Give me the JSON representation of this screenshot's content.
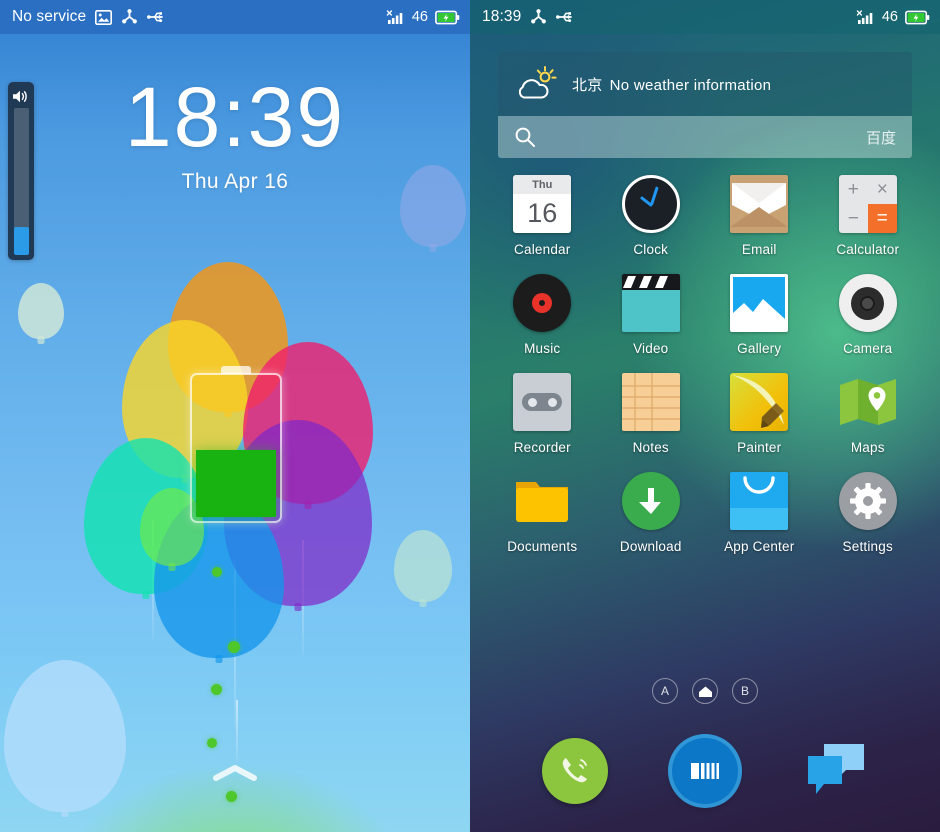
{
  "lock_screen": {
    "status_bar": {
      "carrier": "No service",
      "icons": [
        "screenshot-icon",
        "node-share-icon",
        "usb-icon"
      ],
      "signal_icon": "signal-no-service-icon",
      "battery_percent": "46",
      "battery_icon": "battery-charging-icon"
    },
    "time": "18:39",
    "date": "Thu  Apr 16",
    "volume_slider": {
      "name": "volume-slider",
      "icon": "speaker-icon",
      "level_percent": 19
    },
    "battery_widget": {
      "name": "battery-level-widget",
      "fill_percent": 46
    },
    "unlock_hint_icon": "chevron-up-icon",
    "wallpaper": "balloons"
  },
  "home_screen": {
    "status_bar": {
      "time": "18:39",
      "icons": [
        "node-share-icon",
        "usb-icon"
      ],
      "signal_icon": "signal-no-service-icon",
      "battery_percent": "46",
      "battery_icon": "battery-charging-icon"
    },
    "weather_widget": {
      "icon": "cloud-sun-icon",
      "city": "北京",
      "status": "No weather information"
    },
    "search_bar": {
      "icon": "search-icon",
      "placeholder": "",
      "engine": "百度"
    },
    "apps": [
      {
        "label": "Calendar",
        "icon": "calendar-icon",
        "day_name": "Thu",
        "day_number": "16"
      },
      {
        "label": "Clock",
        "icon": "clock-icon"
      },
      {
        "label": "Email",
        "icon": "email-icon"
      },
      {
        "label": "Calculator",
        "icon": "calculator-icon",
        "keys": [
          "+",
          "×",
          "−",
          "="
        ]
      },
      {
        "label": "Music",
        "icon": "music-vinyl-icon"
      },
      {
        "label": "Video",
        "icon": "video-clapperboard-icon"
      },
      {
        "label": "Gallery",
        "icon": "gallery-photo-icon"
      },
      {
        "label": "Camera",
        "icon": "camera-icon"
      },
      {
        "label": "Recorder",
        "icon": "recorder-cassette-icon"
      },
      {
        "label": "Notes",
        "icon": "notes-icon"
      },
      {
        "label": "Painter",
        "icon": "painter-pencil-icon"
      },
      {
        "label": "Maps",
        "icon": "maps-pin-icon"
      },
      {
        "label": "Documents",
        "icon": "folder-icon"
      },
      {
        "label": "Download",
        "icon": "download-arrow-icon"
      },
      {
        "label": "App Center",
        "icon": "shopping-bag-icon"
      },
      {
        "label": "Settings",
        "icon": "gear-icon"
      }
    ],
    "page_indicators": [
      {
        "label": "A",
        "icon": ""
      },
      {
        "label": "",
        "icon": "home-icon"
      },
      {
        "label": "B",
        "icon": ""
      }
    ],
    "dock": [
      {
        "name": "phone",
        "icon": "phone-icon"
      },
      {
        "name": "app-drawer",
        "icon": "meizu-m-icon"
      },
      {
        "name": "messaging",
        "icon": "message-bubbles-icon"
      }
    ]
  },
  "colors": {
    "lock_sky": "#62aeea",
    "status_blue": "#2a6fc2",
    "home_teal": "#2a7f6a",
    "home_purple": "#2a1c3e",
    "battery_green": "#18b310",
    "accent_blue": "#2196f3"
  }
}
